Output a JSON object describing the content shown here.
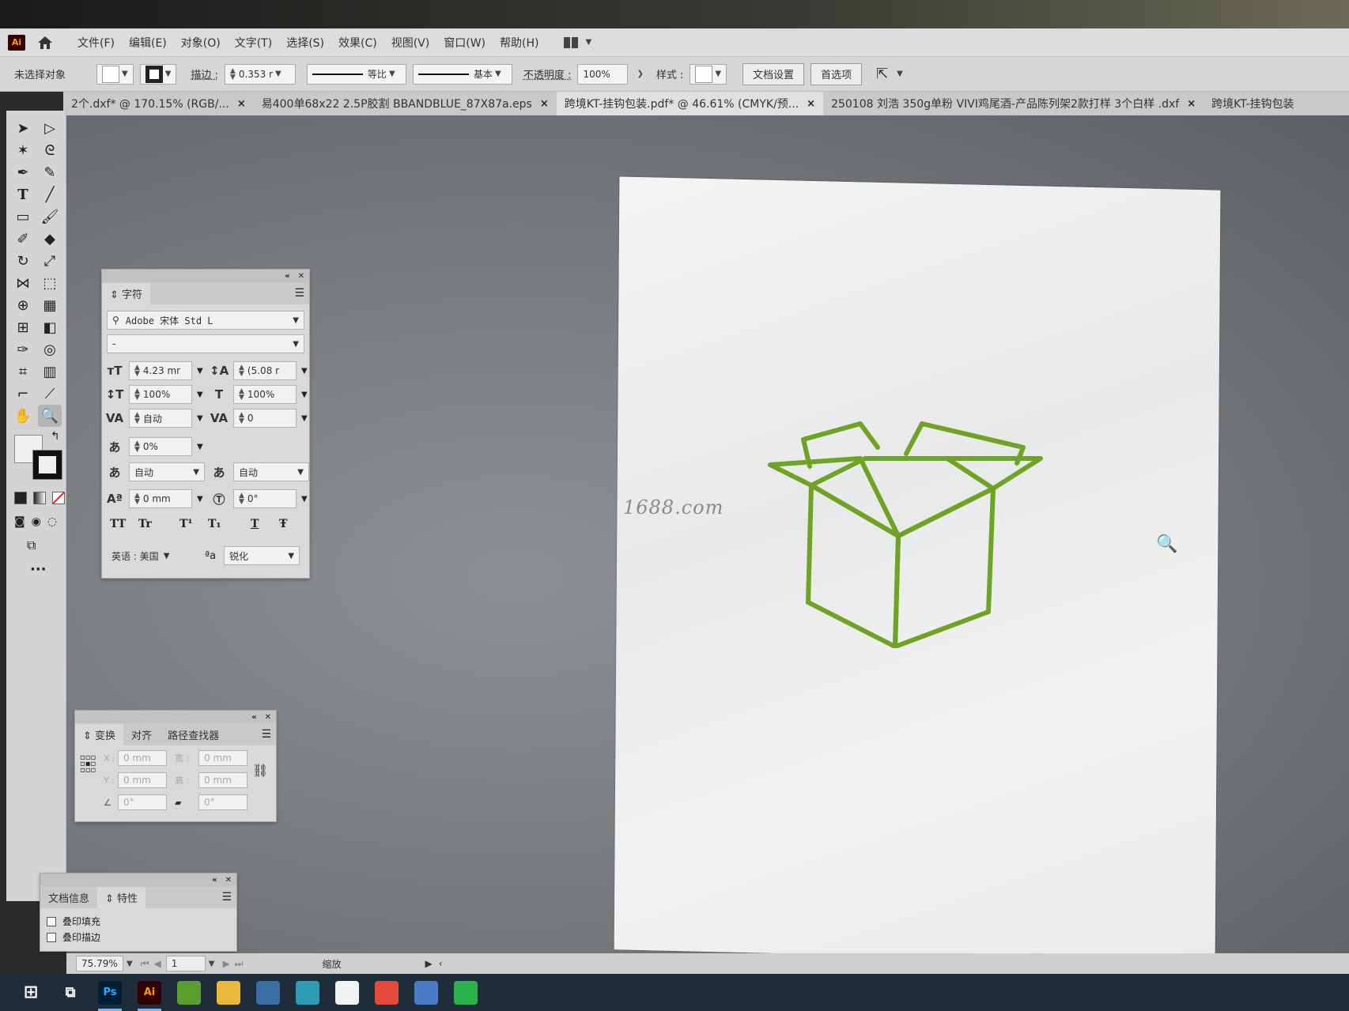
{
  "menubar": {
    "app_logo": "Ai",
    "items": [
      "文件(F)",
      "编辑(E)",
      "对象(O)",
      "文字(T)",
      "选择(S)",
      "效果(C)",
      "视图(V)",
      "窗口(W)",
      "帮助(H)"
    ]
  },
  "controlbar": {
    "selection_label": "未选择对象",
    "stroke_label": "描边 :",
    "stroke_value": "0.353 r",
    "profile_label": "等比",
    "brush_label": "基本",
    "opacity_label": "不透明度 :",
    "opacity_value": "100%",
    "style_label": "样式 :",
    "doc_setup_button": "文档设置",
    "preferences_button": "首选项"
  },
  "tabs": [
    {
      "title": "2个.dxf* @ 170.15% (RGB/..."
    },
    {
      "title": "易400单68x22 2.5P胶割 BBANDBLUE_87X87a.eps"
    },
    {
      "title": "跨境KT-挂钩包装.pdf* @ 46.61% (CMYK/预..."
    },
    {
      "title": "250108 刘浩 350g单粉 VIVI鸡尾酒-产品陈列架2款打样  3个白样  .dxf"
    },
    {
      "title": "跨境KT-挂钩包装"
    }
  ],
  "watermark": "1688.com",
  "character_panel": {
    "tab": "字符",
    "font_family": "Adobe 宋体 Std L",
    "font_style": "-",
    "font_size": "4.23 mr",
    "leading": "(5.08 r",
    "vertical_scale": "100%",
    "horizontal_scale": "100%",
    "kerning": "自动",
    "tracking": "0",
    "tsume": "0%",
    "aki_left": "自动",
    "aki_right": "自动",
    "baseline_shift": "0 mm",
    "rotation": "0°",
    "type_buttons": [
      "TT",
      "Tr",
      "T¹",
      "T₁",
      "T",
      "Ŧ"
    ],
    "language": "英语 : 美国",
    "antialias_label": "ªa",
    "antialias": "锐化"
  },
  "transform_panel": {
    "tabs": [
      "变换",
      "对齐",
      "路径查找器"
    ],
    "x_label": "X :",
    "x_value": "0 mm",
    "y_label": "Y :",
    "y_value": "0 mm",
    "w_label": "宽 :",
    "w_value": "0 mm",
    "h_label": "高 :",
    "h_value": "0 mm",
    "rotate_value": "0°",
    "shear_value": "0°"
  },
  "attributes_panel": {
    "tabs": [
      "文档信息",
      "特性"
    ],
    "overprint_fill": "叠印填充",
    "overprint_stroke": "叠印描边"
  },
  "statusbar": {
    "zoom": "75.79%",
    "artboard_number": "1",
    "tool_name": "缩放"
  },
  "taskbar": {
    "apps": [
      {
        "label": "Ps",
        "color": "#001e36",
        "fg": "#31a8ff"
      },
      {
        "label": "Ai",
        "color": "#330000",
        "fg": "#ff9a00"
      },
      {
        "label": "",
        "color": "#5a9e2f",
        "fg": "#ffffff"
      },
      {
        "label": "",
        "color": "#e8b83a",
        "fg": "#ffffff"
      },
      {
        "label": "",
        "color": "#3a6ea5",
        "fg": "#ffffff"
      },
      {
        "label": "",
        "color": "#2e9cb5",
        "fg": "#ffffff"
      },
      {
        "label": "",
        "color": "#f2f2f2",
        "fg": "#111111"
      },
      {
        "label": "",
        "color": "#e24a3b",
        "fg": "#ffffff"
      },
      {
        "label": "",
        "color": "#4a7cc6",
        "fg": "#ffffff"
      },
      {
        "label": "",
        "color": "#2bb24c",
        "fg": "#ffffff"
      }
    ]
  },
  "colors": {
    "box_stroke": "#6fa324",
    "artboard": "#eeeeee",
    "canvas": "#7a7d80"
  }
}
